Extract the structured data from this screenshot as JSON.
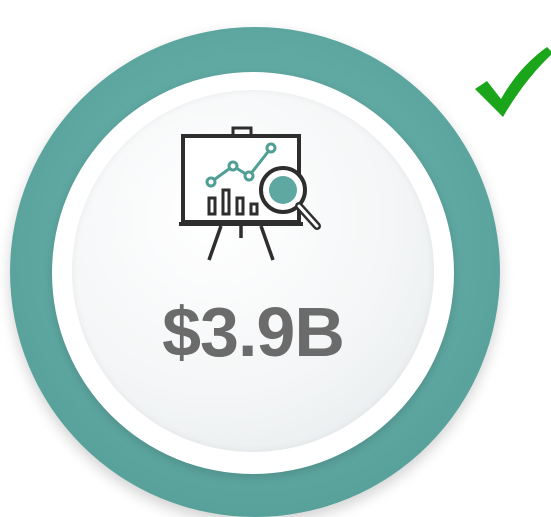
{
  "metric": {
    "value": "$3.9B"
  },
  "icons": {
    "presentation": "presentation-board-chart-magnifier-icon",
    "status": "checkmark-icon"
  },
  "colors": {
    "ring": "#5fa8a2",
    "icon_accent": "#4f9f96",
    "icon_stroke": "#2e2e2e",
    "amount_text": "#6b6b6b",
    "check": "#1aa51a"
  }
}
